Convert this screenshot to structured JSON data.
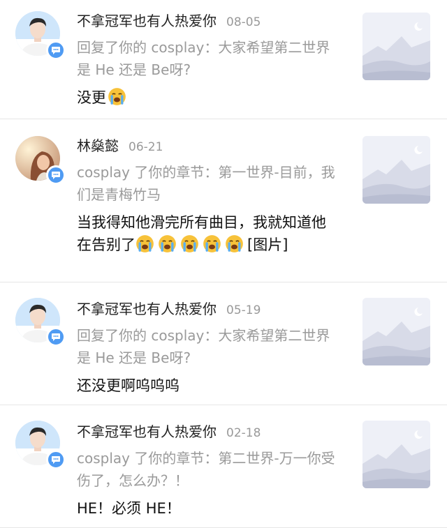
{
  "colors": {
    "badge": "#4f9bf3",
    "quote_text": "#9a9a9a",
    "date_text": "#999999",
    "divider": "#e6e6e6",
    "thumb_bg": "#eef0f7"
  },
  "notifications": [
    {
      "user_name": "不拿冠军也有人热爱你",
      "date": "08-05",
      "quote": "回复了你的 cosplay：大家希望第二世界是 He 还是 Be呀?",
      "body_text": "没更",
      "body_emoji": "loudly-crying-face-emoji",
      "emoji_count": 1,
      "avatar": "avatar-young-man",
      "badge_icon": "comment-bubble-icon",
      "thumb_icon": "image-placeholder-icon"
    },
    {
      "user_name": "林燊懿",
      "date": "06-21",
      "quote": "cosplay 了你的章节：第一世界-目前，我们是青梅竹马",
      "body_text": "当我得知他滑完所有曲目，我就知道他在告别了",
      "body_suffix": "[图片]",
      "body_emoji": "loudly-crying-face-emoji",
      "emoji_count": 5,
      "avatar": "avatar-woman-sunlight",
      "badge_icon": "comment-bubble-icon",
      "thumb_icon": "image-placeholder-icon"
    },
    {
      "user_name": "不拿冠军也有人热爱你",
      "date": "05-19",
      "quote": "回复了你的 cosplay：大家希望第二世界是 He 还是 Be呀?",
      "body_text": "还没更啊呜呜呜",
      "avatar": "avatar-young-man",
      "badge_icon": "comment-bubble-icon",
      "thumb_icon": "image-placeholder-icon"
    },
    {
      "user_name": "不拿冠军也有人热爱你",
      "date": "02-18",
      "quote": "cosplay 了你的章节：第二世界-万一你受伤了，怎么办？！",
      "body_text": "HE！必须 HE！",
      "avatar": "avatar-young-man",
      "badge_icon": "comment-bubble-icon",
      "thumb_icon": "image-placeholder-icon"
    }
  ]
}
